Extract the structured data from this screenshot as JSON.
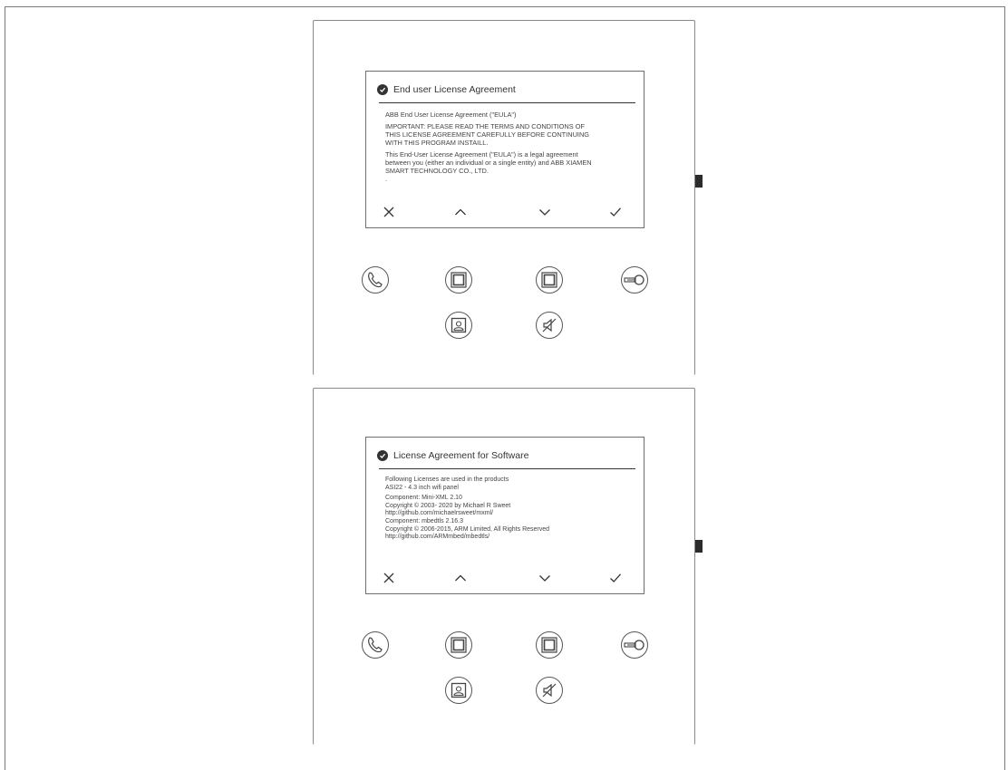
{
  "panels": [
    {
      "title": "End user License Agreement",
      "paragraphs": [
        "ABB End User License Agreement (\"EULA\")",
        "IMPORTANT: PLEASE READ THE TERMS AND CONDITIONS OF\nTHIS LICENSE AGREEMENT CAREFULLY BEFORE CONTINUING\nWITH THIS PROGRAM INSTAILL.",
        "This End-User License Agreement (\"EULA\") is a legal agreement\nbetween you (either an individual or a single entity) and ABB XIAMEN\nSMART TECHNOLOGY CO., LTD.\n."
      ]
    },
    {
      "title": "License Agreement for Software",
      "paragraphs": [
        "Following Licenses are used in the products\nASI22 - 4.3 inch wifi panel",
        "Component: Mini-XML 2.10\nCopyright © 2003- 2020 by Michael R Sweet\nhttp://github.com/michaelrsweet/mxml/\nComponent: mbedtls 2.16.3\nCopyright © 2006-2015, ARM Limited, All Rights Reserved\nhttp://github.com/ARMmbed/mbedtls/"
      ]
    }
  ],
  "icons": {
    "nav": [
      "close-icon",
      "chevron-up-icon",
      "chevron-down-icon",
      "confirm-check-icon"
    ],
    "controls_row1": [
      "phone-icon",
      "square-button-icon",
      "square-button-icon",
      "key-icon"
    ],
    "controls_row2": [
      "surveillance-icon",
      "mute-icon"
    ]
  }
}
